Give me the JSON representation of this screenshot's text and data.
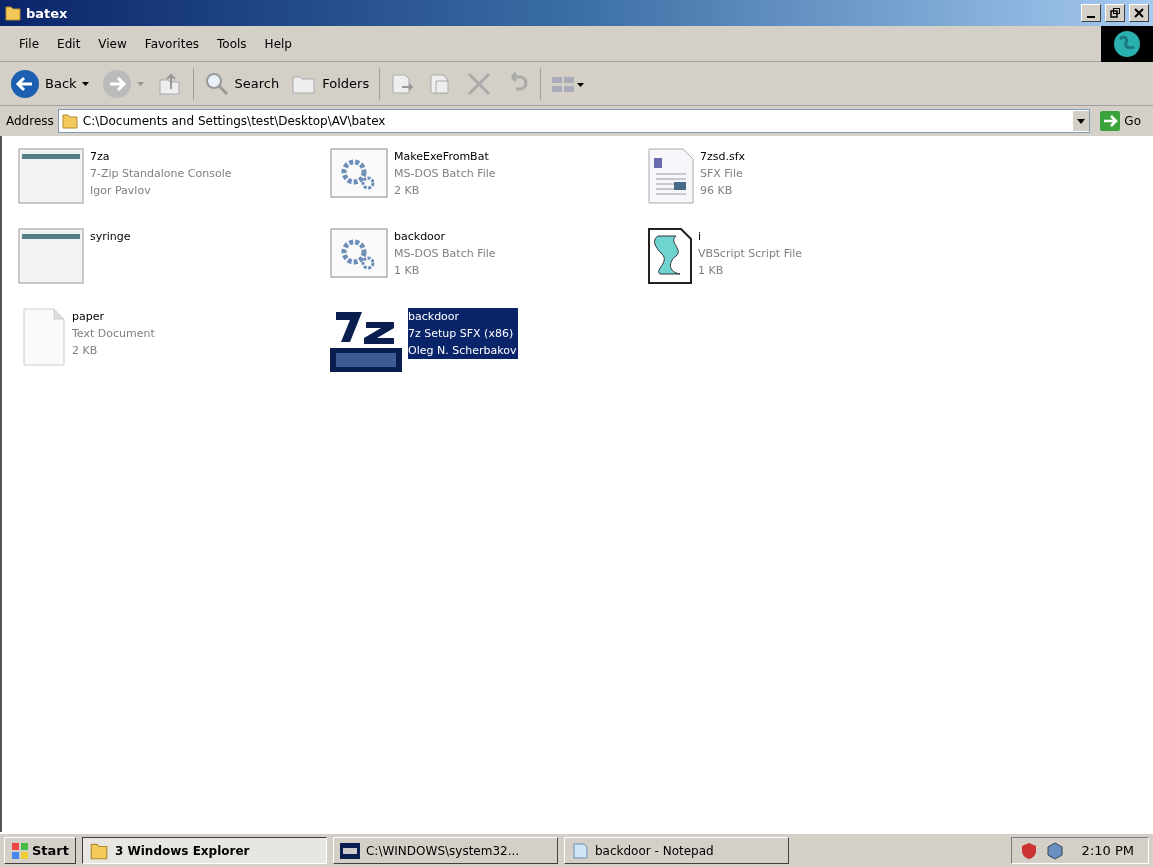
{
  "window": {
    "title": "batex"
  },
  "menu": [
    "File",
    "Edit",
    "View",
    "Favorites",
    "Tools",
    "Help"
  ],
  "toolbar": {
    "back": "Back",
    "search": "Search",
    "folders": "Folders"
  },
  "address": {
    "label": "Address",
    "value": "C:\\Documents and Settings\\test\\Desktop\\AV\\batex",
    "go": "Go"
  },
  "files": [
    {
      "kind": "app",
      "name": "7za",
      "lines": [
        "7-Zip Standalone Console",
        "Igor Pavlov"
      ],
      "selected": false
    },
    {
      "kind": "batch",
      "name": "MakeExeFromBat",
      "lines": [
        "MS-DOS Batch File",
        "2 KB"
      ],
      "selected": false
    },
    {
      "kind": "document",
      "name": "7zsd.sfx",
      "lines": [
        "SFX File",
        "96 KB"
      ],
      "selected": false
    },
    {
      "kind": "app",
      "name": "syringe",
      "selected": false
    },
    {
      "kind": "batch",
      "name": "backdoor",
      "lines": [
        "MS-DOS Batch File",
        "1 KB"
      ],
      "selected": false
    },
    {
      "kind": "script",
      "name": "i",
      "lines": [
        "VBScript Script File",
        "1 KB"
      ],
      "selected": false
    },
    {
      "kind": "text",
      "name": "paper",
      "lines": [
        "Text Document",
        "2 KB"
      ],
      "selected": false
    },
    {
      "kind": "sfx",
      "name": "backdoor",
      "lines": [
        "7z Setup SFX (x86)",
        "Oleg N. Scherbakov"
      ],
      "selected": true
    }
  ],
  "taskbar": {
    "start": "Start",
    "tasks": [
      {
        "kind": "explorer",
        "label": "3 Windows Explorer",
        "selected": true
      },
      {
        "kind": "console",
        "label": "C:\\WINDOWS\\system32...",
        "selected": false
      },
      {
        "kind": "notepad",
        "label": "backdoor - Notepad",
        "selected": false
      }
    ],
    "clock": "2:10 PM"
  }
}
